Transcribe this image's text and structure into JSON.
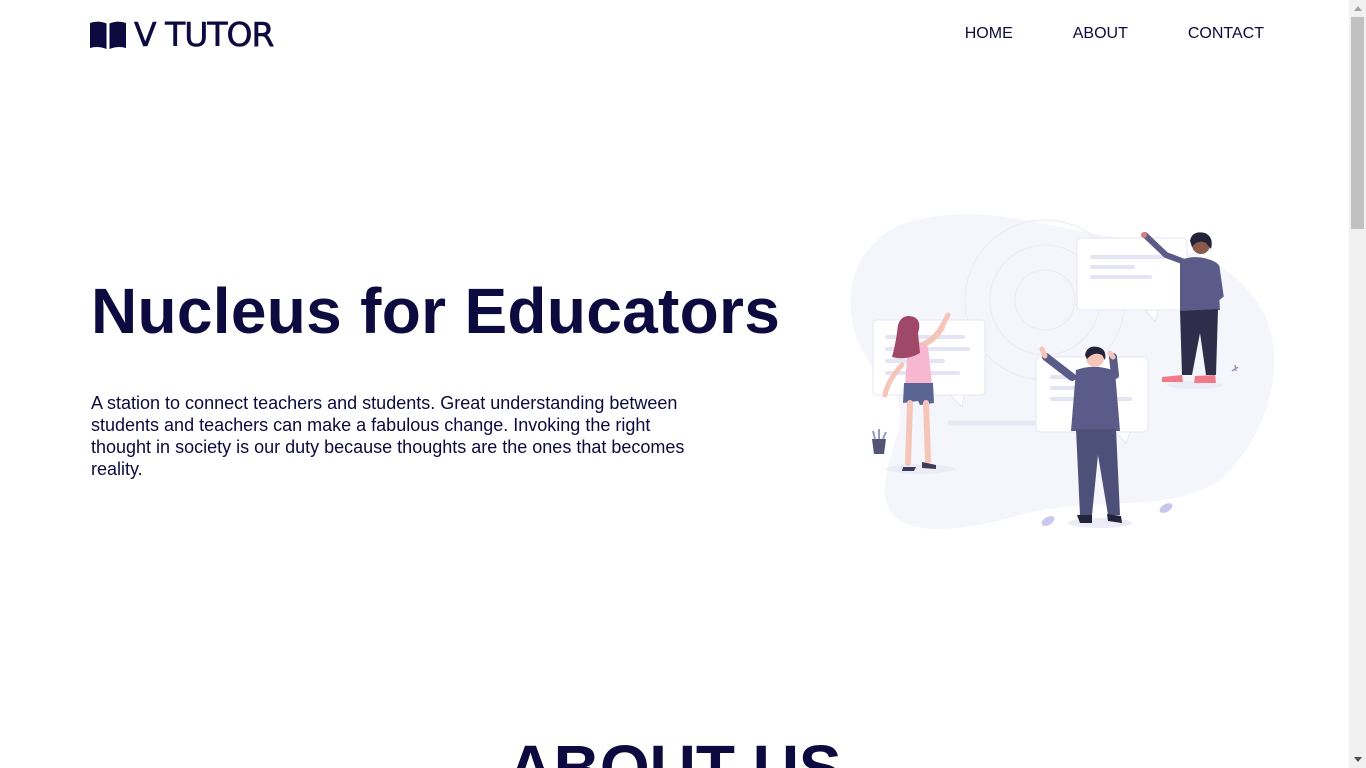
{
  "header": {
    "logo_text": "V TUTOR",
    "logo_icon": "open-book-icon",
    "nav": [
      {
        "label": "HOME"
      },
      {
        "label": "ABOUT"
      },
      {
        "label": "CONTACT"
      }
    ]
  },
  "hero": {
    "title": "Nucleus for Educators",
    "description": "A station to connect teachers and students. Great understanding between students and teachers can make a fabulous change. Invoking the right thought in society is our duty because thoughts are the ones that becomes reality.",
    "illustration": "people-presenting-illustration"
  },
  "about": {
    "title": "ABOUT US"
  },
  "colors": {
    "text": "#0c0a3e",
    "background": "#ffffff",
    "blob": "#f5f5fc",
    "accent_pink": "#f1b8c8",
    "accent_purple": "#5b5b8a"
  }
}
